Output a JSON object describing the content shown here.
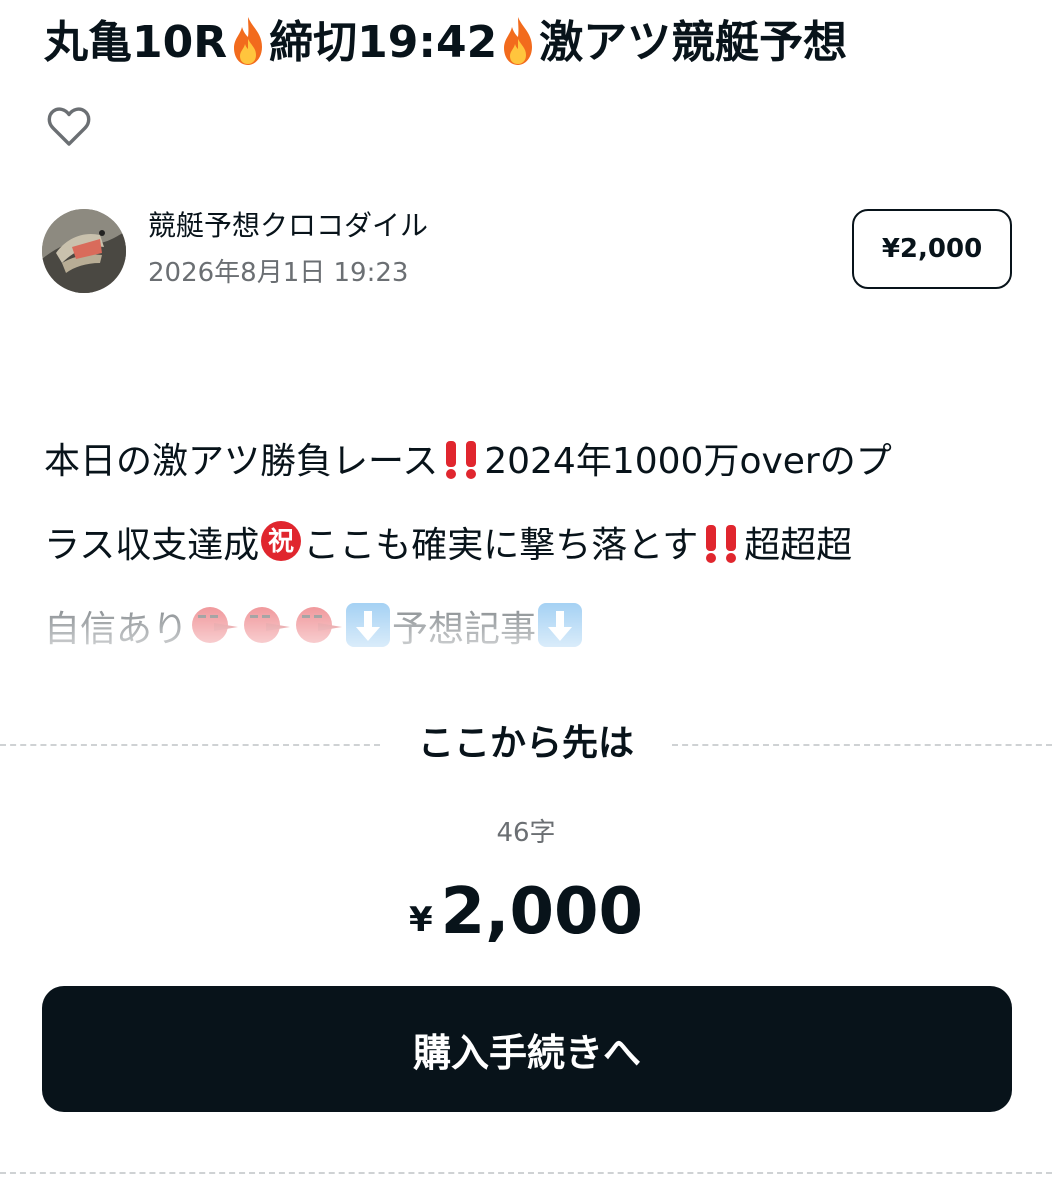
{
  "article": {
    "title_parts": [
      "丸亀10R",
      "締切19:42",
      "激アツ競艇予想"
    ],
    "like_icon": "heart-outline-icon"
  },
  "author": {
    "name": "競艇予想クロコダイル",
    "date": "2026年8月1日 19:23",
    "avatar_icon": "crocodile-avatar"
  },
  "price_badge": "¥2,000",
  "body": {
    "line1_a": "本日の激アツ勝負レース",
    "line1_b": "2024年1000万overのプ",
    "line2_a": "ラス収支達成",
    "line2_b": "ここも確実に撃ち落とす",
    "line2_c": "超超超",
    "line3_a": "自信あり",
    "line3_b": "予想記事"
  },
  "paywall": {
    "label": "ここから先は",
    "char_count": "46字",
    "currency": "¥",
    "amount": "2,000",
    "buy_label": "購入手続きへ"
  },
  "colors": {
    "text": "#08131a",
    "muted": "#6b6f73",
    "button_bg": "#08131a",
    "flame": "#f26b1d",
    "alert": "#e0262e"
  }
}
